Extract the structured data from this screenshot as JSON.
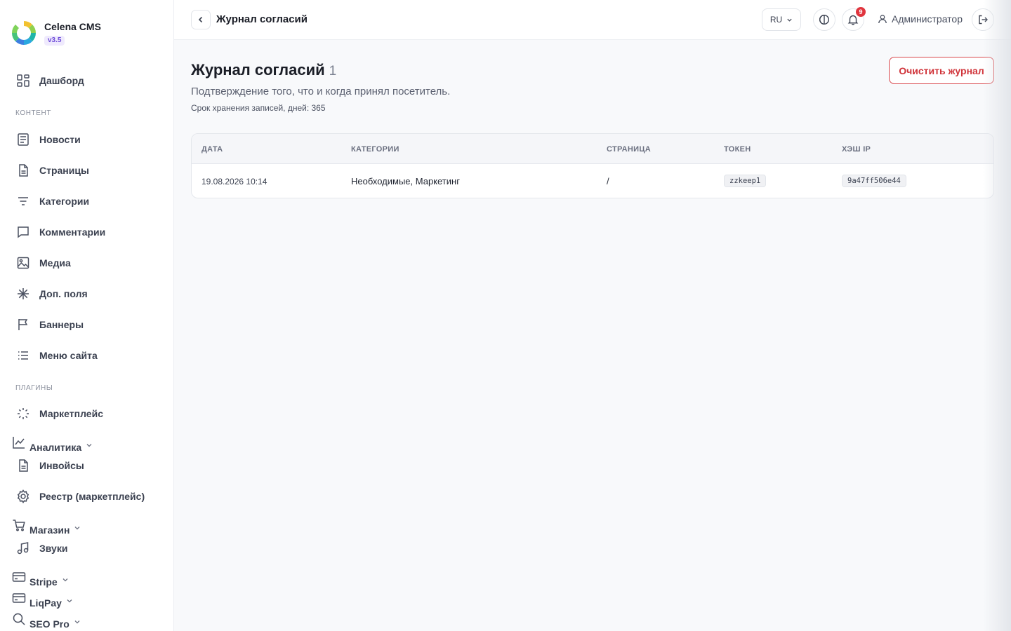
{
  "brand": {
    "name": "Celena CMS",
    "version": "v3.5"
  },
  "sidebar": {
    "dashboard": "Дашборд",
    "section_content": "КОНТЕНТ",
    "content_items": [
      "Новости",
      "Страницы",
      "Категории",
      "Комментарии",
      "Медиа",
      "Доп. поля",
      "Баннеры",
      "Меню сайта"
    ],
    "section_plugins": "ПЛАГИНЫ",
    "plugins": {
      "marketplace": "Маркетплейс",
      "analytics": "Аналитика",
      "invoices": "Инвойсы",
      "registry": "Реестр (маркетплейс)",
      "shop": "Магазин",
      "sounds": "Звуки",
      "stripe": "Stripe",
      "liqpay": "LiqPay",
      "seo": "SEO Pro"
    }
  },
  "topbar": {
    "title": "Журнал согласий",
    "lang": "RU",
    "notifications_count": "9",
    "user": "Администратор"
  },
  "main": {
    "title": "Журнал согласий",
    "count": "1",
    "subtitle": "Подтверждение того, что и когда принял посетитель.",
    "retention": "Срок хранения записей, дней: 365",
    "clear_button": "Очистить журнал",
    "table": {
      "headers": [
        "ДАТА",
        "КАТЕГОРИИ",
        "СТРАНИЦА",
        "ТОКЕН",
        "ХЭШ IP"
      ],
      "rows": [
        {
          "date": "19.08.2026 10:14",
          "categories": "Необходимые, Маркетинг",
          "page": "/",
          "token": "zzkeep1",
          "ip_hash": "9a47ff506e44"
        }
      ]
    }
  },
  "colors": {
    "accent_danger": "#d0343a",
    "badge": "#e0353e",
    "version_badge": "#6d4bd8"
  }
}
